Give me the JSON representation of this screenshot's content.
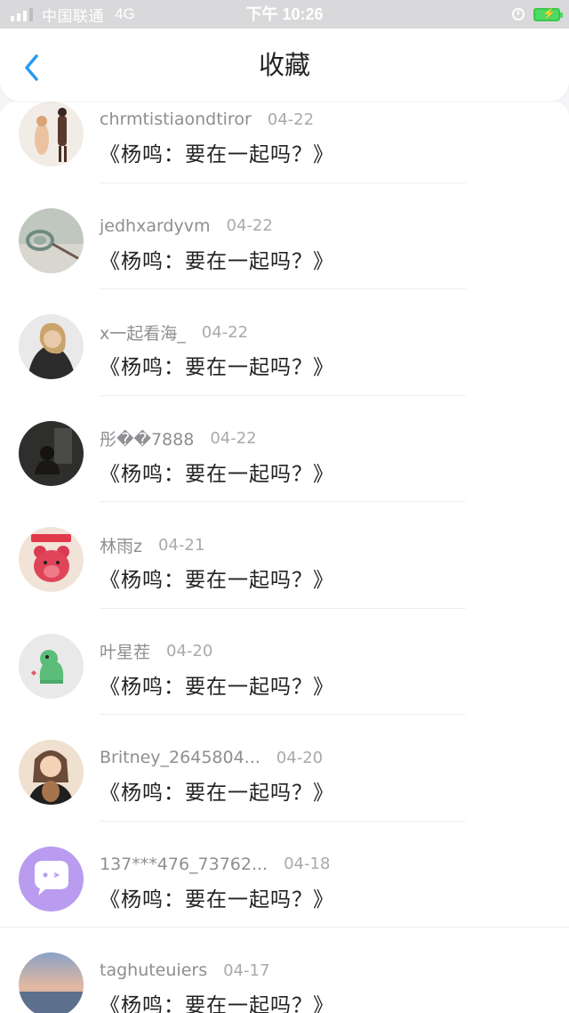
{
  "status_bar": {
    "carrier": "中国联通",
    "network": "4G",
    "time": "下午 10:26"
  },
  "header": {
    "title": "收藏",
    "back_icon": "chevron-left-icon",
    "accent_color": "#2a9bf0"
  },
  "items": [
    {
      "username": "chrmtistiaondtiror",
      "date": "04-22",
      "title": "《杨鸣：要在一起吗？》"
    },
    {
      "username": "jedhxardyvm",
      "date": "04-22",
      "title": "《杨鸣：要在一起吗？》"
    },
    {
      "username": "x一起看海_",
      "date": "04-22",
      "title": "《杨鸣：要在一起吗？》"
    },
    {
      "username": "彤��7888",
      "date": "04-22",
      "title": "《杨鸣：要在一起吗？》"
    },
    {
      "username": "林雨z",
      "date": "04-21",
      "title": "《杨鸣：要在一起吗？》"
    },
    {
      "username": "叶星茬",
      "date": "04-20",
      "title": "《杨鸣：要在一起吗？》"
    },
    {
      "username": "Britney_2645804...",
      "date": "04-20",
      "title": "《杨鸣：要在一起吗？》"
    },
    {
      "username": "137***476_73762...",
      "date": "04-18",
      "title": "《杨鸣：要在一起吗？》"
    },
    {
      "username": "taghuteuiers",
      "date": "04-17",
      "title": "《杨鸣：要在一起吗？》"
    }
  ]
}
